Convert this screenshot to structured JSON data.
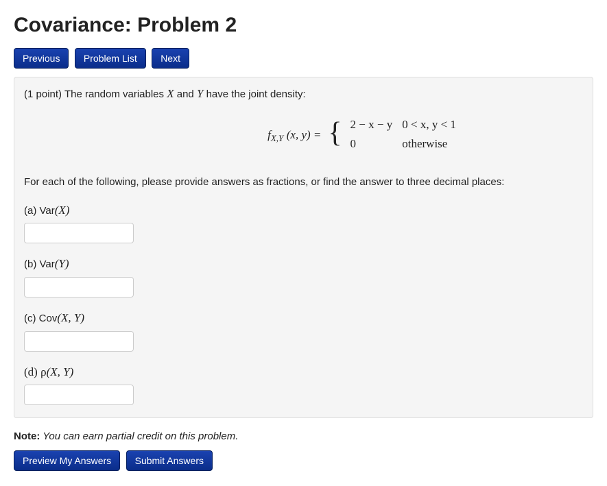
{
  "title": "Covariance: Problem 2",
  "nav": {
    "previous": "Previous",
    "problem_list": "Problem List",
    "next": "Next"
  },
  "problem": {
    "points_prefix": "(1 point) ",
    "intro_1": "The random variables ",
    "var_X": "X",
    "intro_2": " and ",
    "var_Y": "Y",
    "intro_3": " have the joint density:",
    "equation": {
      "func": "f",
      "sub": "X,Y",
      "args": "(x, y) = ",
      "case1_expr": "2 − x − y",
      "case1_cond": "0 < x, y < 1",
      "case2_expr": "0",
      "case2_cond": "otherwise"
    },
    "instruction": "For each of the following, please provide answers as fractions, or find the answer to three decimal places:",
    "parts": {
      "a": {
        "label": "(a) Var",
        "arg": "(X)"
      },
      "b": {
        "label": "(b) Var",
        "arg": "(Y)"
      },
      "c": {
        "label": "(c) Cov",
        "arg": "(X, Y)"
      },
      "d": {
        "label_sym": "(d) ρ",
        "arg": "(X, Y)"
      }
    }
  },
  "note": {
    "prefix": "Note:",
    "text": " You can earn partial credit on this problem."
  },
  "actions": {
    "preview": "Preview My Answers",
    "submit": "Submit Answers"
  }
}
